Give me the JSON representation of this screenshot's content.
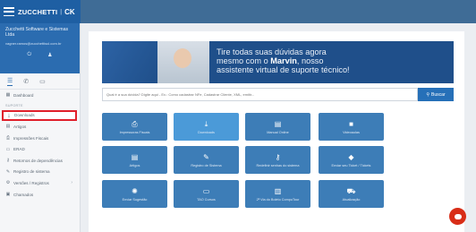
{
  "brand": {
    "name": "ZUCCHETTI",
    "logo": "CK"
  },
  "profile": {
    "company": "Zucchetti Software e Sistemas Ltda",
    "email": "vagner.ramos@zucchettisul.com.br"
  },
  "menu": {
    "dashboard": "Dashboard",
    "section_suporte": "SUPORTE",
    "downloads": "Downloads",
    "artigos": "Artigos",
    "impressoes": "Impressões Fiscais",
    "erad": "ERAD",
    "retornos": "Retornos de dependências",
    "registro": "Registro de sistema",
    "versoes": "Versões / Registros",
    "chamados": "Chamados"
  },
  "banner": {
    "line1": "Tire todas suas dúvidas agora",
    "line2_prefix": "mesmo com o ",
    "line2_bold": "Marvin",
    "line2_suffix": ", nosso",
    "line3": "assistente virtual de suporte técnico!"
  },
  "search": {
    "placeholder": "Qual é a sua dúvida? Digite aqui - Ex.: Como cadastrar NFe, Cadastrar Cliente, XML, emitir...",
    "button": "Buscar"
  },
  "tiles": [
    {
      "label": "Impressoras Fiscais",
      "icon": "printer-icon"
    },
    {
      "label": "Downloads",
      "icon": "download-icon"
    },
    {
      "label": "Manual Online",
      "icon": "book-icon"
    },
    {
      "label": "Videoaulas",
      "icon": "video-icon"
    },
    {
      "label": "Artigos",
      "icon": "document-icon"
    },
    {
      "label": "Registro de Sistema",
      "icon": "pencil-icon"
    },
    {
      "label": "Redefinir senhas do sistema",
      "icon": "key-icon"
    },
    {
      "label": "Enviar seu Ticket / Tickets",
      "icon": "tag-icon"
    },
    {
      "label": "Enviar Sugestão",
      "icon": "bulb-icon"
    },
    {
      "label": "TAO Cursos",
      "icon": "monitor-icon"
    },
    {
      "label": "2ª Via do Boleto CompuTour",
      "icon": "barcode-icon"
    },
    {
      "label": "Atualização",
      "icon": "cart-icon"
    }
  ],
  "colors": {
    "primary": "#2670b8",
    "tile": "#3d7db7",
    "tile_active": "#4b9ad8",
    "highlight": "#e0202b"
  }
}
